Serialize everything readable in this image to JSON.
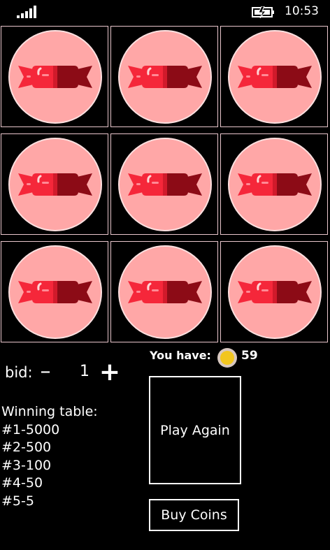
{
  "status_bar": {
    "time": "10:53",
    "signal_icon": "signal-strength-icon",
    "battery_icon": "battery-charging-icon"
  },
  "slots": {
    "symbol_icon": "candy-icon",
    "cells": [
      {
        "symbol": "candy"
      },
      {
        "symbol": "candy"
      },
      {
        "symbol": "candy"
      },
      {
        "symbol": "candy"
      },
      {
        "symbol": "candy"
      },
      {
        "symbol": "candy"
      },
      {
        "symbol": "candy"
      },
      {
        "symbol": "candy"
      },
      {
        "symbol": "candy"
      }
    ]
  },
  "bid": {
    "label": "bid:",
    "minus": "–",
    "value": "1",
    "plus": "+"
  },
  "wallet": {
    "label": "You have:",
    "coins": "59",
    "coin_icon": "coin-icon"
  },
  "winning_table": {
    "title": "Winning table:",
    "rows": [
      "#1-5000",
      "#2-500",
      "#3-100",
      "#4-50",
      "#5-5"
    ]
  },
  "buttons": {
    "play_again": "Play Again",
    "buy_coins": "Buy Coins"
  },
  "colors": {
    "background": "#000000",
    "coin_fill": "#ffa7a7",
    "cell_border": "#e9c6cc",
    "candy_red": "#f5273a",
    "candy_dark": "#8c0b16",
    "gold": "#f2c61f"
  }
}
